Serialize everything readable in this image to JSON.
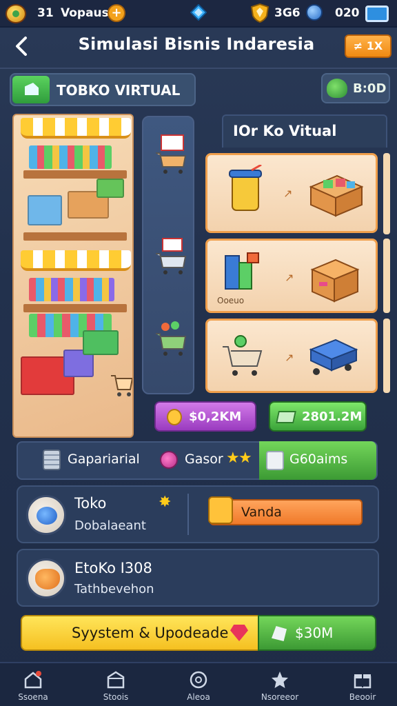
{
  "status_bar": {
    "level": "31",
    "player_name": "Vopaus",
    "plus_label": "+",
    "shield_value": "3G6",
    "globe_value": "020"
  },
  "header": {
    "title": "Simulasi Bisnis Indaresia",
    "speed_label": "≠ 1X"
  },
  "shop": {
    "name": "TOBKO VIRTUAL",
    "cash_value": "B:0D"
  },
  "panel": {
    "title": "IOr Ko Vitual",
    "card_labels": [
      "Ooeuo"
    ]
  },
  "money_buttons": {
    "purple": "$0,2KM",
    "green": "2801.2M"
  },
  "stats": {
    "left": "Gapariarial",
    "middle": "Gasor",
    "right": "G60aims"
  },
  "row1": {
    "title": "Toko",
    "subtitle": "Dobalaeant",
    "button_label": "Vanda"
  },
  "row2": {
    "title": "EtoKo I308",
    "subtitle": "Tathbevehon"
  },
  "update": {
    "label": "Syystem & Upodeade",
    "green_label": "$30M"
  },
  "bottom_nav": [
    {
      "label": "Ssoena",
      "icon": "home-icon"
    },
    {
      "label": "Stoois",
      "icon": "store-icon"
    },
    {
      "label": "Aleoa",
      "icon": "clock-icon"
    },
    {
      "label": "Nsoreeor",
      "icon": "star-icon"
    },
    {
      "label": "Beooir",
      "icon": "gift-icon"
    }
  ],
  "colors": {
    "accent_orange": "#f08a12",
    "accent_green": "#3ba33a",
    "accent_purple": "#9a3bc0",
    "accent_yellow": "#f5c021"
  }
}
